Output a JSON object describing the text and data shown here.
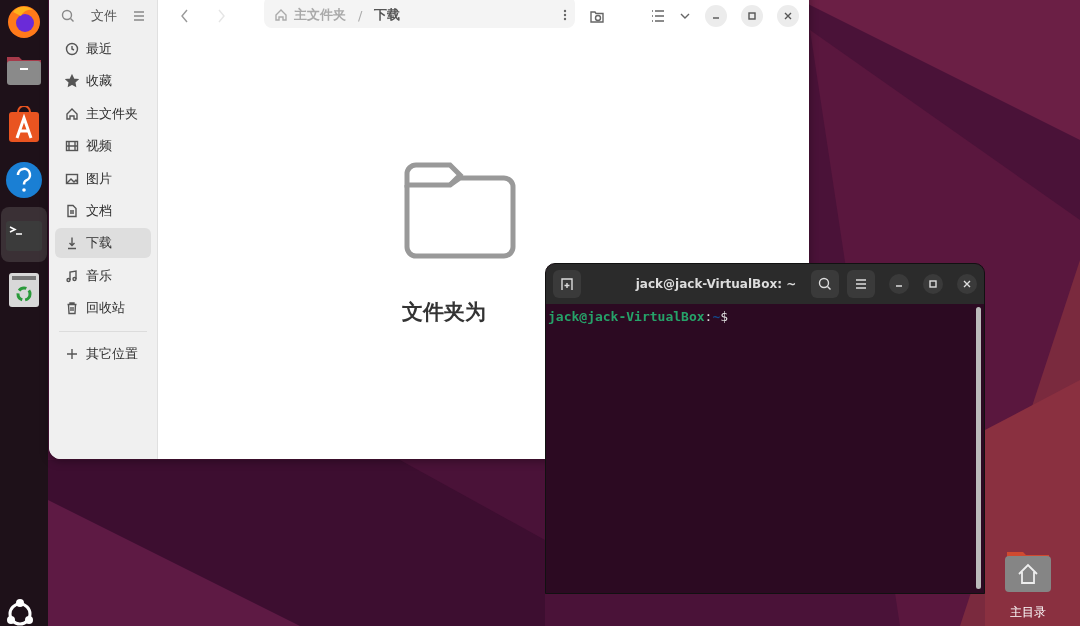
{
  "dock": {
    "items": [
      {
        "kind": "browser",
        "selected": false
      },
      {
        "kind": "files",
        "selected": false
      },
      {
        "kind": "store",
        "selected": false
      },
      {
        "kind": "help",
        "selected": false
      },
      {
        "kind": "terminal",
        "selected": true
      },
      {
        "kind": "trash",
        "selected": false
      }
    ]
  },
  "files_window": {
    "sidebar": {
      "title": "文件",
      "places": [
        {
          "kind": "recent",
          "label": "最近",
          "selected": false
        },
        {
          "kind": "starred",
          "label": "收藏",
          "selected": false
        },
        {
          "kind": "home",
          "label": "主文件夹",
          "selected": false
        },
        {
          "kind": "videos",
          "label": "视频",
          "selected": false
        },
        {
          "kind": "pictures",
          "label": "图片",
          "selected": false
        },
        {
          "kind": "documents",
          "label": "文档",
          "selected": false
        },
        {
          "kind": "downloads",
          "label": "下载",
          "selected": true
        },
        {
          "kind": "music",
          "label": "音乐",
          "selected": false
        },
        {
          "kind": "trash",
          "label": "回收站",
          "selected": false
        }
      ],
      "other_locations": "其它位置"
    },
    "forward_disabled": true,
    "path": {
      "crumbs": [
        "主文件夹",
        "下载"
      ],
      "separator": "/"
    },
    "empty_message": "文件夹为"
  },
  "terminal": {
    "title": "jack@jack-VirtualBox: ~",
    "prompt": {
      "user_host": "jack@jack-VirtualBox",
      "colon": ":",
      "path": "~",
      "symbol": "$"
    }
  },
  "desktop_icon": {
    "label": "主目录"
  }
}
